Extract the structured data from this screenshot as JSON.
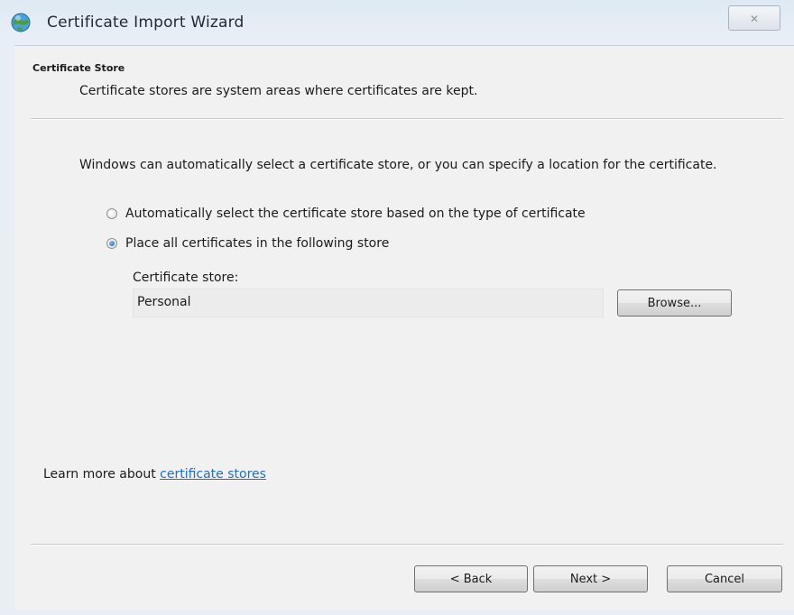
{
  "window": {
    "title": "Certificate Import Wizard",
    "close_glyph": "✕"
  },
  "header": {
    "title": "Certificate Store",
    "description": "Certificate stores are system areas where certificates are kept."
  },
  "body": {
    "intro": "Windows can automatically select a certificate store, or you can specify a location for the certificate.",
    "options": [
      {
        "label": "Automatically select the certificate store based on the type of certificate",
        "checked": false
      },
      {
        "label": "Place all certificates in the following store",
        "checked": true
      }
    ],
    "store_label": "Certificate store:",
    "store_value": "Personal",
    "browse_label": "Browse..."
  },
  "footer": {
    "learn_prefix": "Learn more about ",
    "learn_link": "certificate stores",
    "back_label": "< Back",
    "next_label": "Next >",
    "cancel_label": "Cancel"
  },
  "colors": {
    "link": "#1c6fcc",
    "radio_selected": "#1a5fb4"
  },
  "icons": {
    "title": "certificate-globe-icon",
    "close": "close-icon"
  }
}
